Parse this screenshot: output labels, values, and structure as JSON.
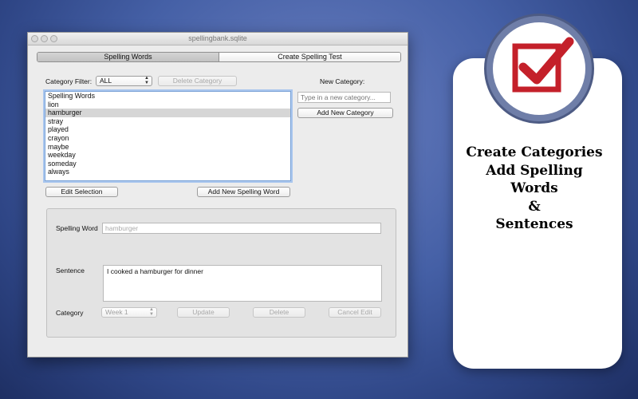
{
  "window": {
    "title": "spellingbank.sqlite",
    "tabs": [
      {
        "label": "Spelling Words",
        "active": true
      },
      {
        "label": "Create Spelling Test",
        "active": false
      }
    ]
  },
  "category_filter": {
    "label": "Category Filter:",
    "value": "ALL",
    "delete_button": "Delete Category"
  },
  "new_category": {
    "label": "New Category:",
    "placeholder": "Type in a new category...",
    "add_button": "Add New Category"
  },
  "word_list": {
    "items": [
      "Spelling Words",
      "lion",
      "hamburger",
      "stray",
      "played",
      "crayon",
      "maybe",
      "weekday",
      "someday",
      "always"
    ],
    "selected_index": 2
  },
  "actions": {
    "edit_selection": "Edit Selection",
    "add_word": "Add New Spelling Word"
  },
  "editor": {
    "word_label": "Spelling Word",
    "word_value": "hamburger",
    "sentence_label": "Sentence",
    "sentence_value": "I cooked a hamburger for dinner",
    "category_label": "Category",
    "category_value": "Week 1",
    "update_button": "Update",
    "delete_button": "Delete",
    "cancel_button": "Cancel Edit"
  },
  "promo": {
    "lines": [
      "Create Categories",
      "Add Spelling",
      "Words",
      "&",
      "Sentences"
    ],
    "icon": "checkbox-check-icon",
    "colors": {
      "check": "#c4202a",
      "badge": "#6f7ea8"
    }
  }
}
